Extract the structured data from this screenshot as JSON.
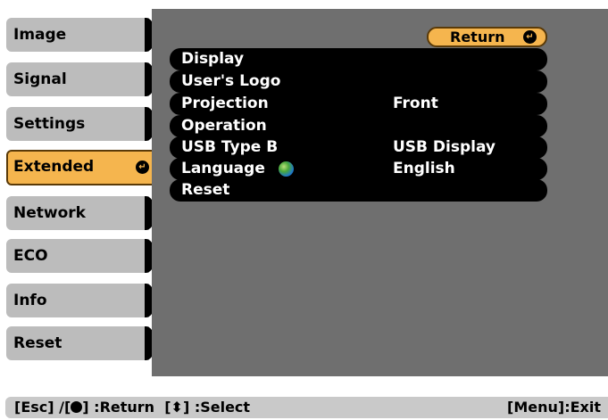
{
  "sidebar": {
    "items": [
      {
        "label": "Image"
      },
      {
        "label": "Signal"
      },
      {
        "label": "Settings"
      },
      {
        "label": "Extended"
      },
      {
        "label": "Network"
      },
      {
        "label": "ECO"
      },
      {
        "label": "Info"
      },
      {
        "label": "Reset"
      }
    ]
  },
  "panel": {
    "return_label": "Return",
    "rows": [
      {
        "label": "Display",
        "value": ""
      },
      {
        "label": "User's Logo",
        "value": ""
      },
      {
        "label": "Projection",
        "value": "Front"
      },
      {
        "label": "Operation",
        "value": ""
      },
      {
        "label": "USB Type B",
        "value": "USB Display"
      },
      {
        "label": "Language",
        "value": "English"
      },
      {
        "label": "Reset",
        "value": ""
      }
    ]
  },
  "footer": {
    "esc": "[Esc] /[",
    "return_text": "] :Return",
    "select_open": "[",
    "select_text": "] :Select",
    "exit": "[Menu]:Exit"
  },
  "colors": {
    "accent": "#f5b54e",
    "tab": "#bcbcbc",
    "panel": "#6f6f6f"
  }
}
